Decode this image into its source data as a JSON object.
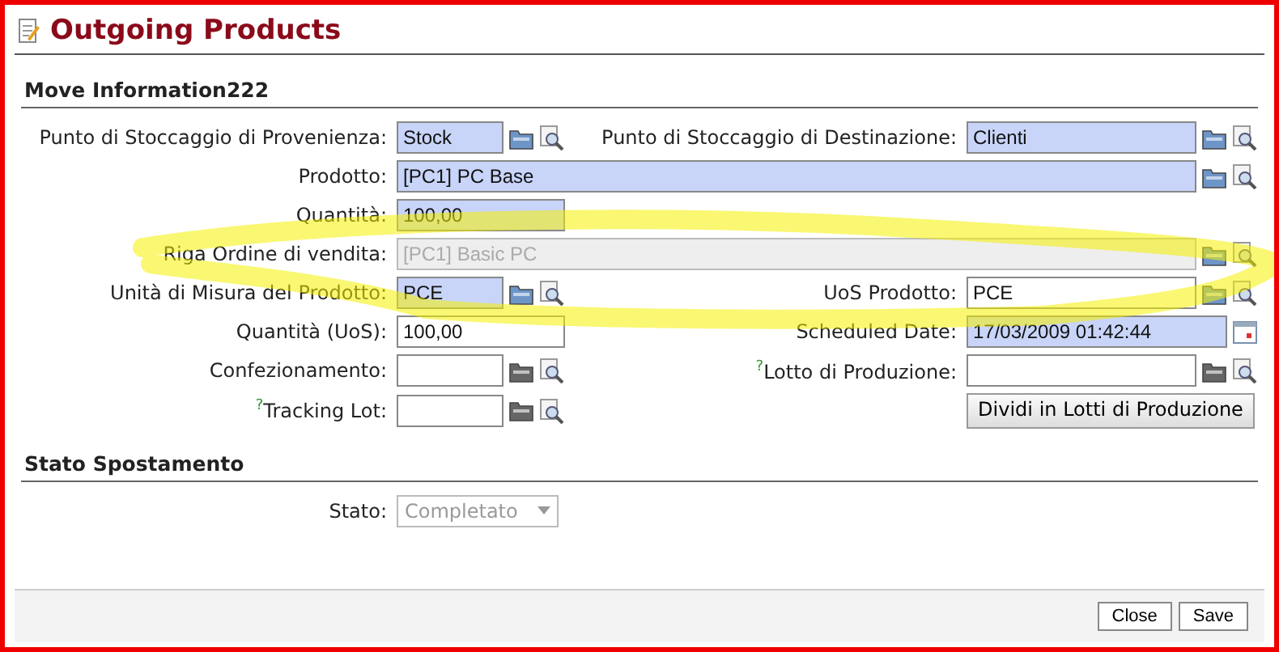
{
  "title": "Outgoing Products",
  "sections": [
    {
      "title": "Move Information222",
      "rows": [
        {
          "fields": [
            {
              "kind": "lookup",
              "label": "Punto di Stoccaggio di Provenienza:",
              "value": "Stock",
              "required": true,
              "readonly": false
            },
            {
              "kind": "lookup",
              "label": "Punto di Stoccaggio di Destinazione:",
              "value": "Clienti",
              "required": true,
              "readonly": false
            }
          ]
        },
        {
          "fields": [
            {
              "kind": "lookup",
              "label": "Prodotto:",
              "value": "[PC1] PC Base",
              "required": true,
              "readonly": false,
              "wide": true
            }
          ]
        },
        {
          "fields": [
            {
              "kind": "text",
              "label": "Quantità:",
              "value": "100,00",
              "required": true,
              "readonly": false
            }
          ]
        },
        {
          "fields": [
            {
              "kind": "lookup",
              "label": "Riga Ordine di vendita:",
              "value": "[PC1] Basic PC",
              "readonly": true,
              "wide": true
            }
          ]
        },
        {
          "fields": [
            {
              "kind": "lookup",
              "label": "Unità di Misura del Prodotto:",
              "value": "PCE",
              "required": true,
              "readonly": false
            },
            {
              "kind": "lookup",
              "label": "UoS Prodotto:",
              "value": "PCE",
              "required": false,
              "readonly": false
            }
          ]
        },
        {
          "fields": [
            {
              "kind": "text",
              "label": "Quantità (UoS):",
              "value": "100,00",
              "required": false,
              "readonly": false
            },
            {
              "kind": "date",
              "label": "Scheduled Date:",
              "value": "17/03/2009 01:42:44",
              "required": true,
              "readonly": false
            }
          ]
        },
        {
          "fields": [
            {
              "kind": "lookup",
              "label": "Confezionamento:",
              "required": false,
              "readonly": false
            },
            {
              "kind": "lookup",
              "label": "$^{?}$Lotto di Produzione:",
              "required": false,
              "readonly": false
            }
          ]
        },
        {
          "fields": [
            {
              "kind": "lookup",
              "label": "$^{?}$Tracking Lot:",
              "required": false,
              "readonly": false
            },
            {
              "kind": "button",
              "value": "Dividi in Lotti di Produzione"
            }
          ]
        }
      ]
    },
    {
      "title": "Stato Spostamento",
      "rows": [
        {
          "fields": [
            {
              "kind": "select",
              "label": "Stato:",
              "value": "Completato",
              "readonly": true
            }
          ]
        }
      ]
    }
  ],
  "buttons": [
    "Close",
    "Save"
  ]
}
